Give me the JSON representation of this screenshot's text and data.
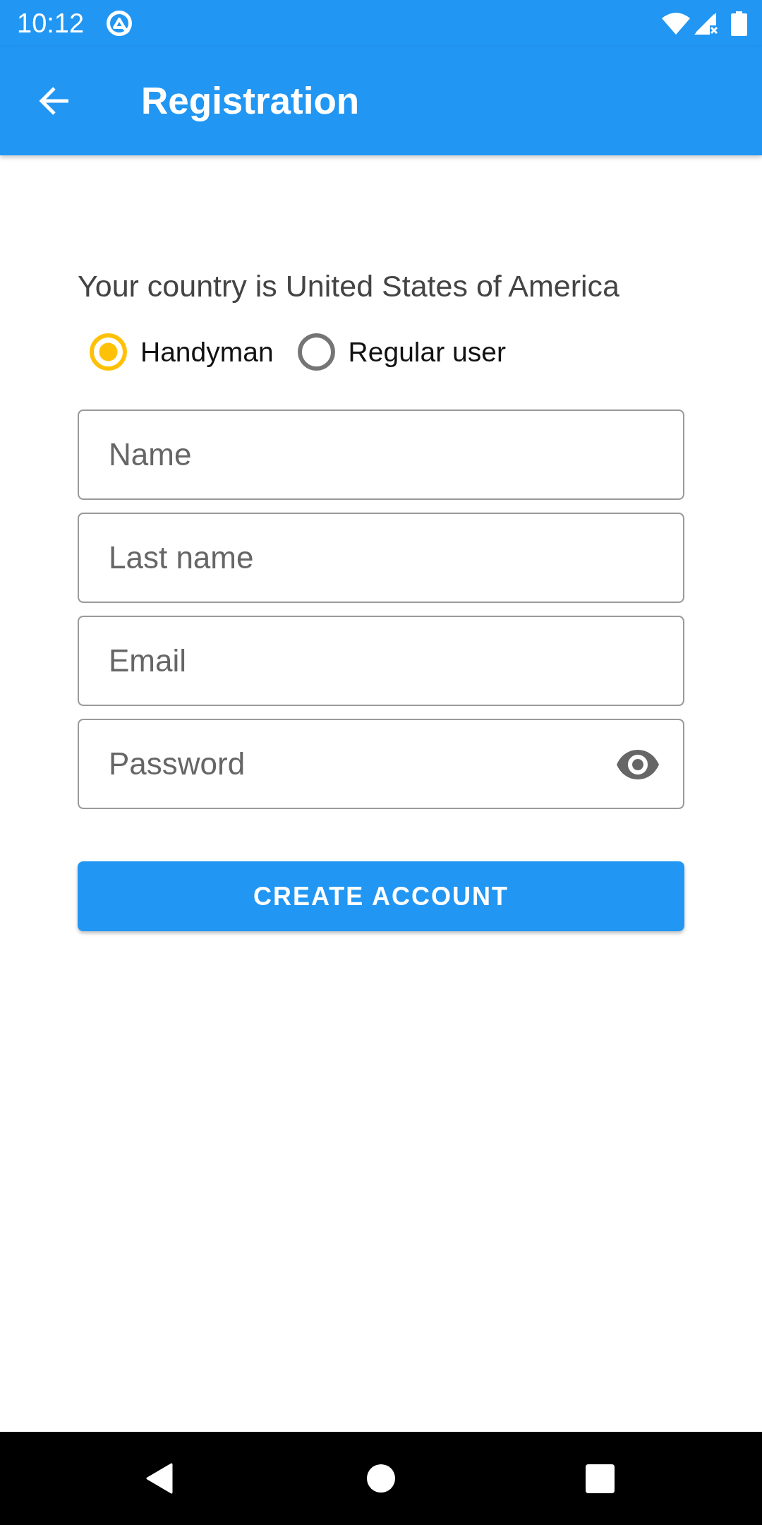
{
  "status_bar": {
    "time": "10:12"
  },
  "app_bar": {
    "title": "Registration"
  },
  "country_text": "Your country is United States of America",
  "user_types": [
    {
      "label": "Handyman",
      "selected": true
    },
    {
      "label": "Regular user",
      "selected": false
    }
  ],
  "fields": [
    {
      "kind": "text",
      "placeholder": "Name"
    },
    {
      "kind": "text",
      "placeholder": "Last name"
    },
    {
      "kind": "email",
      "placeholder": "Email"
    },
    {
      "kind": "password",
      "placeholder": "Password"
    }
  ],
  "create_button": {
    "label": "CREATE ACCOUNT"
  }
}
